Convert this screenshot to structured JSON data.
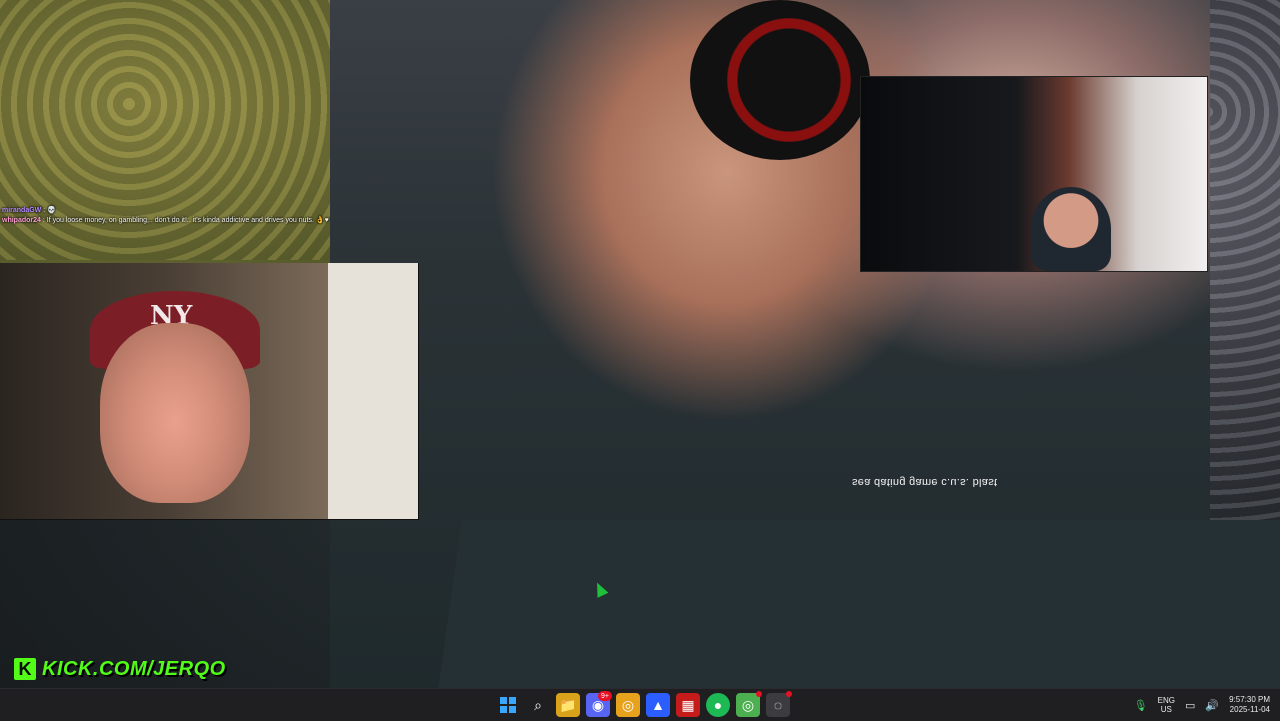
{
  "chat": {
    "messages": [
      {
        "username": "mirandaGW",
        "sep": ":",
        "text": "💀"
      },
      {
        "username": "whipador24",
        "sep": ":",
        "text": "If you loose money, on gambling,.. don't do it!.. it's kinda addictive and drives you nuts. 👌♥"
      }
    ]
  },
  "stream": {
    "kick_url": "KICK.COM/JERQO",
    "overlay_caption_mirrored": "sea dating game c.u.s. blast"
  },
  "left_cam": {
    "cap_logo": "NY"
  },
  "taskbar": {
    "icons": [
      {
        "name": "start",
        "glyph": "⊞"
      },
      {
        "name": "search",
        "glyph": "⌕"
      },
      {
        "name": "file-explorer",
        "glyph": "📁"
      },
      {
        "name": "discord",
        "glyph": "◉",
        "badge": "9+"
      },
      {
        "name": "chrome",
        "glyph": "◎"
      },
      {
        "name": "app-a",
        "glyph": "▲"
      },
      {
        "name": "app-red",
        "glyph": "▦"
      },
      {
        "name": "spotify",
        "glyph": "●"
      },
      {
        "name": "chrome-2",
        "glyph": "◎"
      },
      {
        "name": "app-circle",
        "glyph": "◌"
      }
    ],
    "tray": {
      "lang_line1": "ENG",
      "lang_line2": "US",
      "time": "9:57:30 PM",
      "date": "2025-11-04"
    }
  },
  "colors": {
    "kick_green": "#53fc18",
    "taskbar_bg": "#1f1f22"
  }
}
